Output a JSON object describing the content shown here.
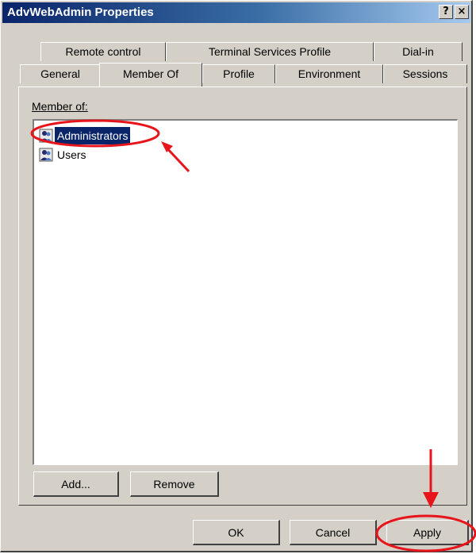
{
  "window": {
    "title": "AdvWebAdmin Properties",
    "help_glyph": "?",
    "close_glyph": "×"
  },
  "tabs_back": [
    "Remote control",
    "Terminal Services Profile",
    "Dial-in"
  ],
  "tabs_front": [
    "General",
    "Member Of",
    "Profile",
    "Environment",
    "Sessions"
  ],
  "active_tab": "Member Of",
  "member_of": {
    "label": "Member of:",
    "items": [
      {
        "name": "Administrators",
        "selected": true
      },
      {
        "name": "Users",
        "selected": false
      }
    ]
  },
  "panel_buttons": {
    "add": "Add...",
    "remove": "Remove"
  },
  "dialog_buttons": {
    "ok": "OK",
    "cancel": "Cancel",
    "apply": "Apply"
  },
  "colors": {
    "selection": "#0a246a",
    "annotation": "#e8141c",
    "titlebar_start": "#0a246a"
  }
}
